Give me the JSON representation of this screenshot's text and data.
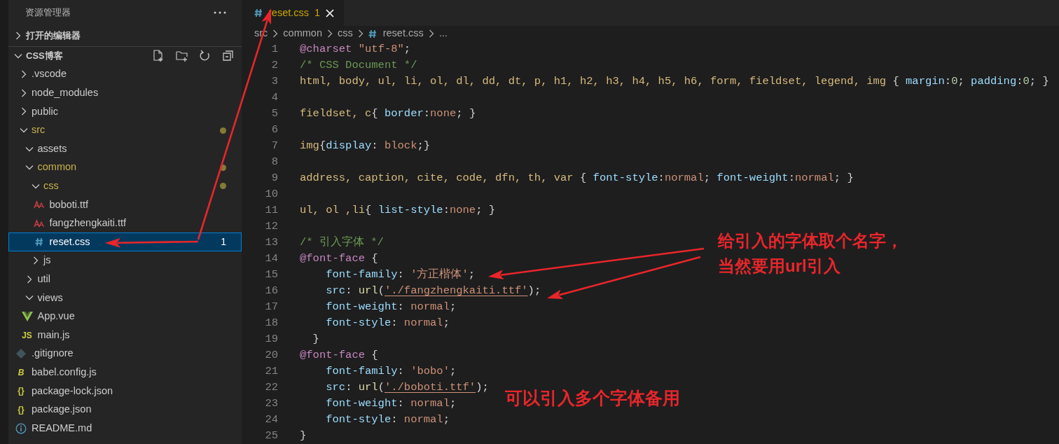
{
  "explorer": {
    "title": "资源管理器",
    "sections": [
      {
        "label": "打开的编辑器",
        "expanded": false
      },
      {
        "label": "CSS博客",
        "expanded": true,
        "tree": [
          {
            "name": ".vscode",
            "kind": "folder",
            "expanded": false,
            "modified": false,
            "selected": false
          },
          {
            "name": "node_modules",
            "kind": "folder",
            "expanded": false,
            "modified": false,
            "selected": false
          },
          {
            "name": "public",
            "kind": "folder",
            "expanded": false,
            "modified": false,
            "selected": false
          },
          {
            "name": "src",
            "kind": "folder",
            "expanded": true,
            "modified": true,
            "selected": false,
            "children": [
              {
                "name": "assets",
                "kind": "folder",
                "expanded": true,
                "modified": false,
                "selected": false
              },
              {
                "name": "common",
                "kind": "folder",
                "expanded": true,
                "modified": true,
                "selected": false,
                "children": [
                  {
                    "name": "css",
                    "kind": "folder",
                    "expanded": true,
                    "modified": true,
                    "selected": false,
                    "children": [
                      {
                        "name": "boboti.ttf",
                        "kind": "font",
                        "modified": false,
                        "selected": false
                      },
                      {
                        "name": "fangzhengkaiti.ttf",
                        "kind": "font",
                        "modified": false,
                        "selected": false
                      },
                      {
                        "name": "reset.css",
                        "kind": "css",
                        "modified": false,
                        "selected": true,
                        "badge": "1"
                      }
                    ]
                  },
                  {
                    "name": "js",
                    "kind": "folder",
                    "expanded": false,
                    "modified": false,
                    "selected": false
                  }
                ]
              },
              {
                "name": "util",
                "kind": "folder",
                "expanded": false,
                "modified": false,
                "selected": false
              },
              {
                "name": "views",
                "kind": "folder",
                "expanded": true,
                "modified": false,
                "selected": false
              },
              {
                "name": "App.vue",
                "kind": "vue",
                "modified": false,
                "selected": false
              },
              {
                "name": "main.js",
                "kind": "labeled",
                "icon_label": "JS",
                "modified": false,
                "selected": false
              }
            ]
          },
          {
            "name": ".gitignore",
            "kind": "git",
            "modified": false,
            "selected": false
          },
          {
            "name": "babel.config.js",
            "kind": "labeled",
            "icon_label": "B",
            "modified": false,
            "selected": false
          },
          {
            "name": "package-lock.json",
            "kind": "labeled",
            "icon_label": "{}",
            "modified": false,
            "selected": false
          },
          {
            "name": "package.json",
            "kind": "labeled",
            "icon_label": "{}",
            "modified": false,
            "selected": false
          },
          {
            "name": "README.md",
            "kind": "info",
            "modified": false,
            "selected": false
          }
        ]
      }
    ]
  },
  "tabs": [
    {
      "label": "reset.css",
      "badge": "1",
      "selected": true,
      "warning": true
    }
  ],
  "breadcrumbs": [
    {
      "text": "src",
      "kind": "folder"
    },
    {
      "text": "common",
      "kind": "folder"
    },
    {
      "text": "css",
      "kind": "folder"
    },
    {
      "text": "reset.css",
      "kind": "css"
    },
    {
      "text": "...",
      "kind": "more"
    }
  ],
  "code": [
    {
      "number": "1",
      "tokens": [
        {
          "kind": "at",
          "text": "@charset"
        },
        {
          "kind": "string",
          "text": " \"utf-8\""
        },
        {
          "kind": "punct",
          "text": ";"
        }
      ]
    },
    {
      "number": "2",
      "tokens": [
        {
          "kind": "comment",
          "text": "/* CSS Document */"
        }
      ]
    },
    {
      "number": "3",
      "tokens": [
        {
          "kind": "selector",
          "text": "html, body, ul, li, ol, dl, dd, dt, p, h1, h2, h3, h4, h5, h6, form, fieldset, legend, img"
        },
        {
          "kind": "punct",
          "text": " { "
        },
        {
          "kind": "property",
          "text": "margin"
        },
        {
          "kind": "punct",
          "text": ":"
        },
        {
          "kind": "number",
          "text": "0"
        },
        {
          "kind": "punct",
          "text": "; "
        },
        {
          "kind": "property",
          "text": "padding"
        },
        {
          "kind": "punct",
          "text": ":"
        },
        {
          "kind": "number",
          "text": "0"
        },
        {
          "kind": "punct",
          "text": "; }"
        }
      ]
    },
    {
      "number": "4"
    },
    {
      "number": "5",
      "tokens": [
        {
          "kind": "selector",
          "text": "fieldset, c"
        },
        {
          "kind": "punct",
          "text": "{ "
        },
        {
          "kind": "property",
          "text": "border"
        },
        {
          "kind": "punct",
          "text": ":"
        },
        {
          "kind": "value",
          "text": "none"
        },
        {
          "kind": "punct",
          "text": "; }"
        }
      ]
    },
    {
      "number": "6"
    },
    {
      "number": "7",
      "tokens": [
        {
          "kind": "selector",
          "text": "img"
        },
        {
          "kind": "punct",
          "text": "{"
        },
        {
          "kind": "property",
          "text": "display"
        },
        {
          "kind": "punct",
          "text": ": "
        },
        {
          "kind": "value",
          "text": "block"
        },
        {
          "kind": "punct",
          "text": ";}"
        }
      ]
    },
    {
      "number": "8"
    },
    {
      "number": "9",
      "tokens": [
        {
          "kind": "selector",
          "text": "address, caption, cite, code, dfn, th, var"
        },
        {
          "kind": "punct",
          "text": " { "
        },
        {
          "kind": "property",
          "text": "font-style"
        },
        {
          "kind": "punct",
          "text": ":"
        },
        {
          "kind": "value",
          "text": "normal"
        },
        {
          "kind": "punct",
          "text": "; "
        },
        {
          "kind": "property",
          "text": "font-weight"
        },
        {
          "kind": "punct",
          "text": ":"
        },
        {
          "kind": "value",
          "text": "normal"
        },
        {
          "kind": "punct",
          "text": "; }"
        }
      ]
    },
    {
      "number": "10"
    },
    {
      "number": "11",
      "tokens": [
        {
          "kind": "selector",
          "text": "ul, ol ,li"
        },
        {
          "kind": "punct",
          "text": "{ "
        },
        {
          "kind": "property",
          "text": "list-style"
        },
        {
          "kind": "punct",
          "text": ":"
        },
        {
          "kind": "value",
          "text": "none"
        },
        {
          "kind": "punct",
          "text": "; }"
        }
      ]
    },
    {
      "number": "12"
    },
    {
      "number": "13",
      "tokens": [
        {
          "kind": "comment",
          "text": "/* 引入字体 */"
        }
      ]
    },
    {
      "number": "14",
      "tokens": [
        {
          "kind": "at",
          "text": "@font-face"
        },
        {
          "kind": "punct",
          "text": " {"
        }
      ]
    },
    {
      "number": "15",
      "tokens": [
        {
          "kind": "property",
          "text": "    font-family"
        },
        {
          "kind": "punct",
          "text": ": "
        },
        {
          "kind": "string",
          "text": "'方正楷体'"
        },
        {
          "kind": "punct",
          "text": ";"
        }
      ]
    },
    {
      "number": "16",
      "tokens": [
        {
          "kind": "property",
          "text": "    src"
        },
        {
          "kind": "punct",
          "text": ": "
        },
        {
          "kind": "function",
          "text": "url"
        },
        {
          "kind": "punct",
          "text": "("
        },
        {
          "kind": "link",
          "text": "'./fangzhengkaiti.ttf'"
        },
        {
          "kind": "punct",
          "text": ");"
        }
      ]
    },
    {
      "number": "17",
      "tokens": [
        {
          "kind": "property",
          "text": "    font-weight"
        },
        {
          "kind": "punct",
          "text": ": "
        },
        {
          "kind": "value",
          "text": "normal"
        },
        {
          "kind": "punct",
          "text": ";"
        }
      ]
    },
    {
      "number": "18",
      "tokens": [
        {
          "kind": "property",
          "text": "    font-style"
        },
        {
          "kind": "punct",
          "text": ": "
        },
        {
          "kind": "value",
          "text": "normal"
        },
        {
          "kind": "punct",
          "text": ";"
        }
      ]
    },
    {
      "number": "19",
      "tokens": [
        {
          "kind": "punct",
          "text": "  }"
        }
      ]
    },
    {
      "number": "20",
      "tokens": [
        {
          "kind": "at",
          "text": "@font-face"
        },
        {
          "kind": "punct",
          "text": " {"
        }
      ]
    },
    {
      "number": "21",
      "tokens": [
        {
          "kind": "property",
          "text": "    font-family"
        },
        {
          "kind": "punct",
          "text": ": "
        },
        {
          "kind": "string",
          "text": "'bobo'"
        },
        {
          "kind": "punct",
          "text": ";"
        }
      ]
    },
    {
      "number": "22",
      "tokens": [
        {
          "kind": "property",
          "text": "    src"
        },
        {
          "kind": "punct",
          "text": ": "
        },
        {
          "kind": "function",
          "text": "url"
        },
        {
          "kind": "punct",
          "text": "("
        },
        {
          "kind": "link",
          "text": "'./boboti.ttf'"
        },
        {
          "kind": "punct",
          "text": ");"
        }
      ]
    },
    {
      "number": "23",
      "tokens": [
        {
          "kind": "property",
          "text": "    font-weight"
        },
        {
          "kind": "punct",
          "text": ": "
        },
        {
          "kind": "value",
          "text": "normal"
        },
        {
          "kind": "punct",
          "text": ";"
        }
      ]
    },
    {
      "number": "24",
      "tokens": [
        {
          "kind": "property",
          "text": "    font-style"
        },
        {
          "kind": "punct",
          "text": ": "
        },
        {
          "kind": "value",
          "text": "normal"
        },
        {
          "kind": "punct",
          "text": ";"
        }
      ]
    },
    {
      "number": "25",
      "tokens": [
        {
          "kind": "punct",
          "text": "}"
        }
      ]
    }
  ],
  "annotations": [
    {
      "kind": "callout",
      "lines": [
        "给引入的字体取个名字，",
        "当然要用url引入"
      ]
    },
    {
      "kind": "callout",
      "lines": [
        "可以引入多个字体备用"
      ]
    }
  ]
}
